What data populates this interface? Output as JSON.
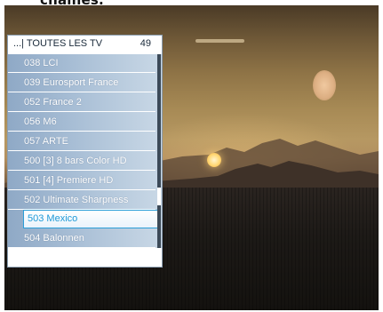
{
  "caption": "chaînes.",
  "channel_list": {
    "title": "...| TOUTES LES TV",
    "count": "49",
    "selected_index": 9,
    "items": [
      "038 LCI",
      "039 Eurosport France",
      "052 France 2",
      "056 M6",
      "057 ARTE",
      "500 [3] 8 bars Color HD",
      "501 [4] Premiere HD",
      "502 Ultimate Sharpness",
      "503 Mexico",
      "504 Balonnen"
    ]
  },
  "colors": {
    "selected_text": "#1f9ad8",
    "selected_border": "#2d9fd8",
    "list_background": "#a9bfd6",
    "scrollbar": "#3c4a58"
  }
}
